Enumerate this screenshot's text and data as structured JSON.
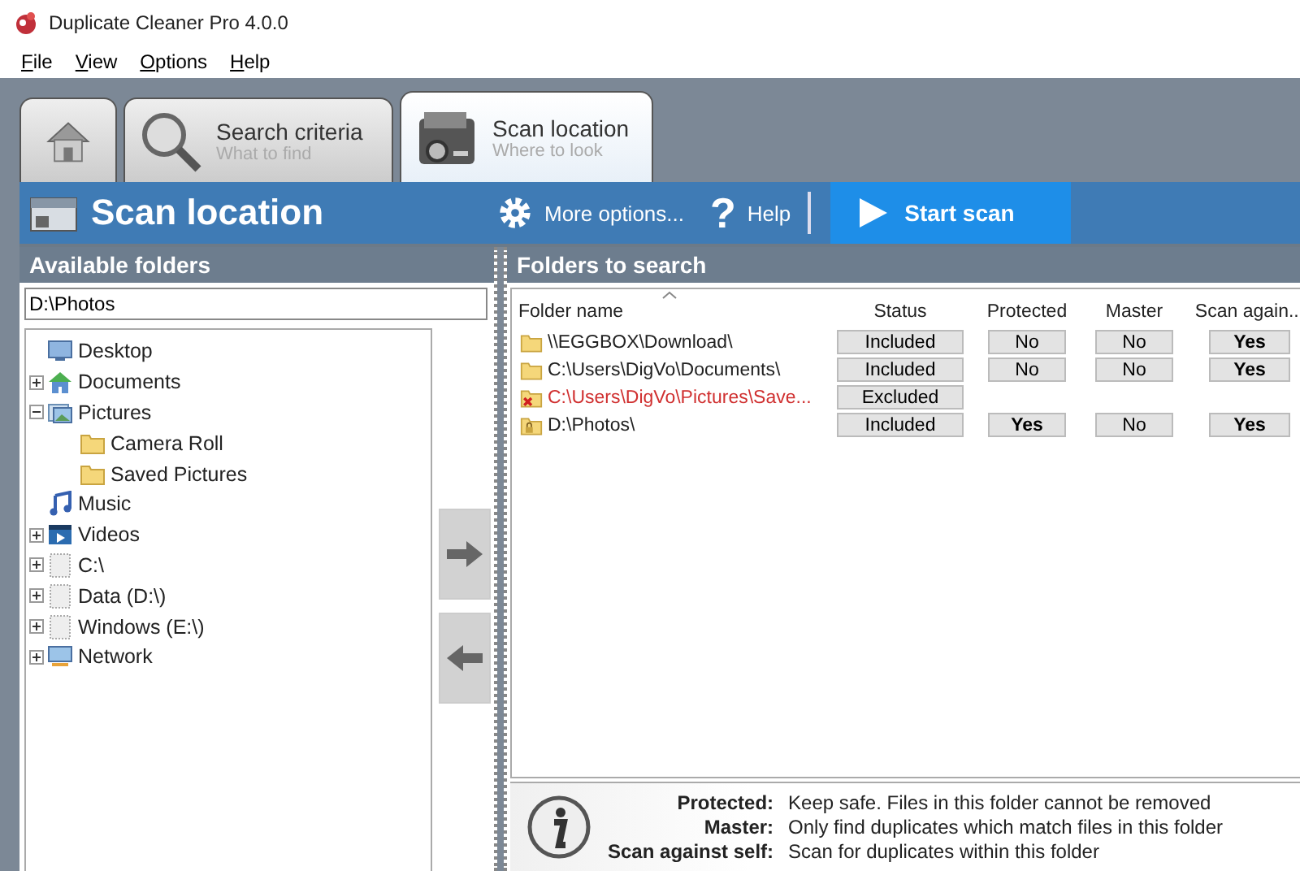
{
  "window": {
    "title": "Duplicate Cleaner Pro 4.0.0"
  },
  "menu": [
    {
      "label": "File"
    },
    {
      "label": "View"
    },
    {
      "label": "Options"
    },
    {
      "label": "Help"
    }
  ],
  "tabs": [
    {
      "kind": "home",
      "selected": false
    },
    {
      "kind": "search",
      "title": "Search criteria",
      "subtitle": "What to find",
      "selected": false
    },
    {
      "kind": "scan",
      "title": "Scan location",
      "subtitle": "Where to look",
      "selected": true
    }
  ],
  "header": {
    "title": "Scan location",
    "more_options": "More options...",
    "help_icon": "?",
    "help": "Help",
    "start": "Start scan"
  },
  "available": {
    "title": "Available folders",
    "path": "D:\\Photos",
    "tree": [
      {
        "label": "Desktop",
        "kind": "desktop"
      },
      {
        "label": "Documents",
        "kind": "home",
        "expanded": false
      },
      {
        "label": "Pictures",
        "kind": "pictures",
        "expanded": true,
        "children": [
          {
            "label": "Camera Roll",
            "kind": "folder"
          },
          {
            "label": "Saved Pictures",
            "kind": "folder"
          }
        ]
      },
      {
        "label": "Music",
        "kind": "music"
      },
      {
        "label": "Videos",
        "kind": "videos",
        "expanded": false
      },
      {
        "label": "C:\\",
        "kind": "drive",
        "expanded": false
      },
      {
        "label": "Data (D:\\)",
        "kind": "drive",
        "expanded": false
      },
      {
        "label": "Windows (E:\\)",
        "kind": "drive",
        "expanded": false
      },
      {
        "label": "Network",
        "kind": "network",
        "expanded": false
      }
    ]
  },
  "search": {
    "title": "Folders to search",
    "columns": [
      "Folder name",
      "Status",
      "Protected",
      "Master",
      "Scan again..."
    ],
    "rows": [
      {
        "folder": "\\\\EGGBOX\\Download\\",
        "excluded": false,
        "status": "Included",
        "protected": "No",
        "master": "No",
        "scan_self": "Yes"
      },
      {
        "folder": "C:\\Users\\DigVo\\Documents\\",
        "excluded": false,
        "status": "Included",
        "protected": "No",
        "master": "No",
        "scan_self": "Yes"
      },
      {
        "folder": "C:\\Users\\DigVo\\Pictures\\Save...",
        "excluded": true,
        "status": "Excluded"
      },
      {
        "folder": "D:\\Photos\\",
        "excluded": false,
        "status": "Included",
        "protected": "Yes",
        "master": "No",
        "scan_self": "Yes"
      }
    ]
  },
  "info": [
    {
      "term": "Protected:",
      "text": "Keep safe. Files in this folder cannot be removed"
    },
    {
      "term": "Master:",
      "text": "Only find duplicates which match files in this folder"
    },
    {
      "term": "Scan against self:",
      "text": "Scan for duplicates within this folder"
    }
  ]
}
